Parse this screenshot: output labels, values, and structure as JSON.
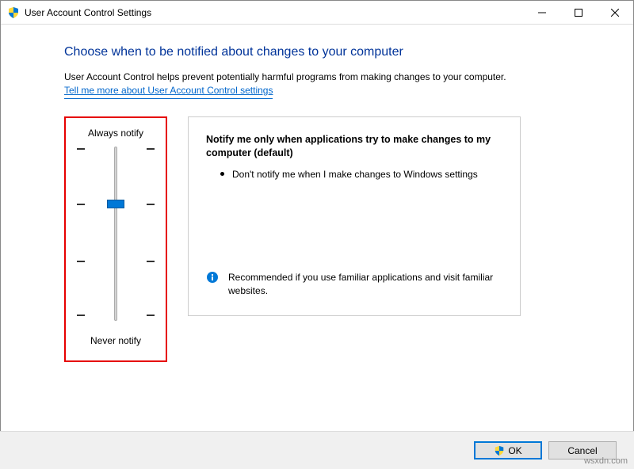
{
  "window": {
    "title": "User Account Control Settings"
  },
  "heading": "Choose when to be notified about changes to your computer",
  "description": "User Account Control helps prevent potentially harmful programs from making changes to your computer.",
  "link_text": "Tell me more about User Account Control settings",
  "slider": {
    "top_label": "Always notify",
    "bottom_label": "Never notify",
    "levels": 4,
    "current_level": 2
  },
  "info": {
    "title": "Notify me only when applications try to make changes to my computer (default)",
    "bullet": "Don't notify me when I make changes to Windows settings",
    "recommendation": "Recommended if you use familiar applications and visit familiar websites."
  },
  "buttons": {
    "ok": "OK",
    "cancel": "Cancel"
  },
  "watermark": "wsxdn.com"
}
